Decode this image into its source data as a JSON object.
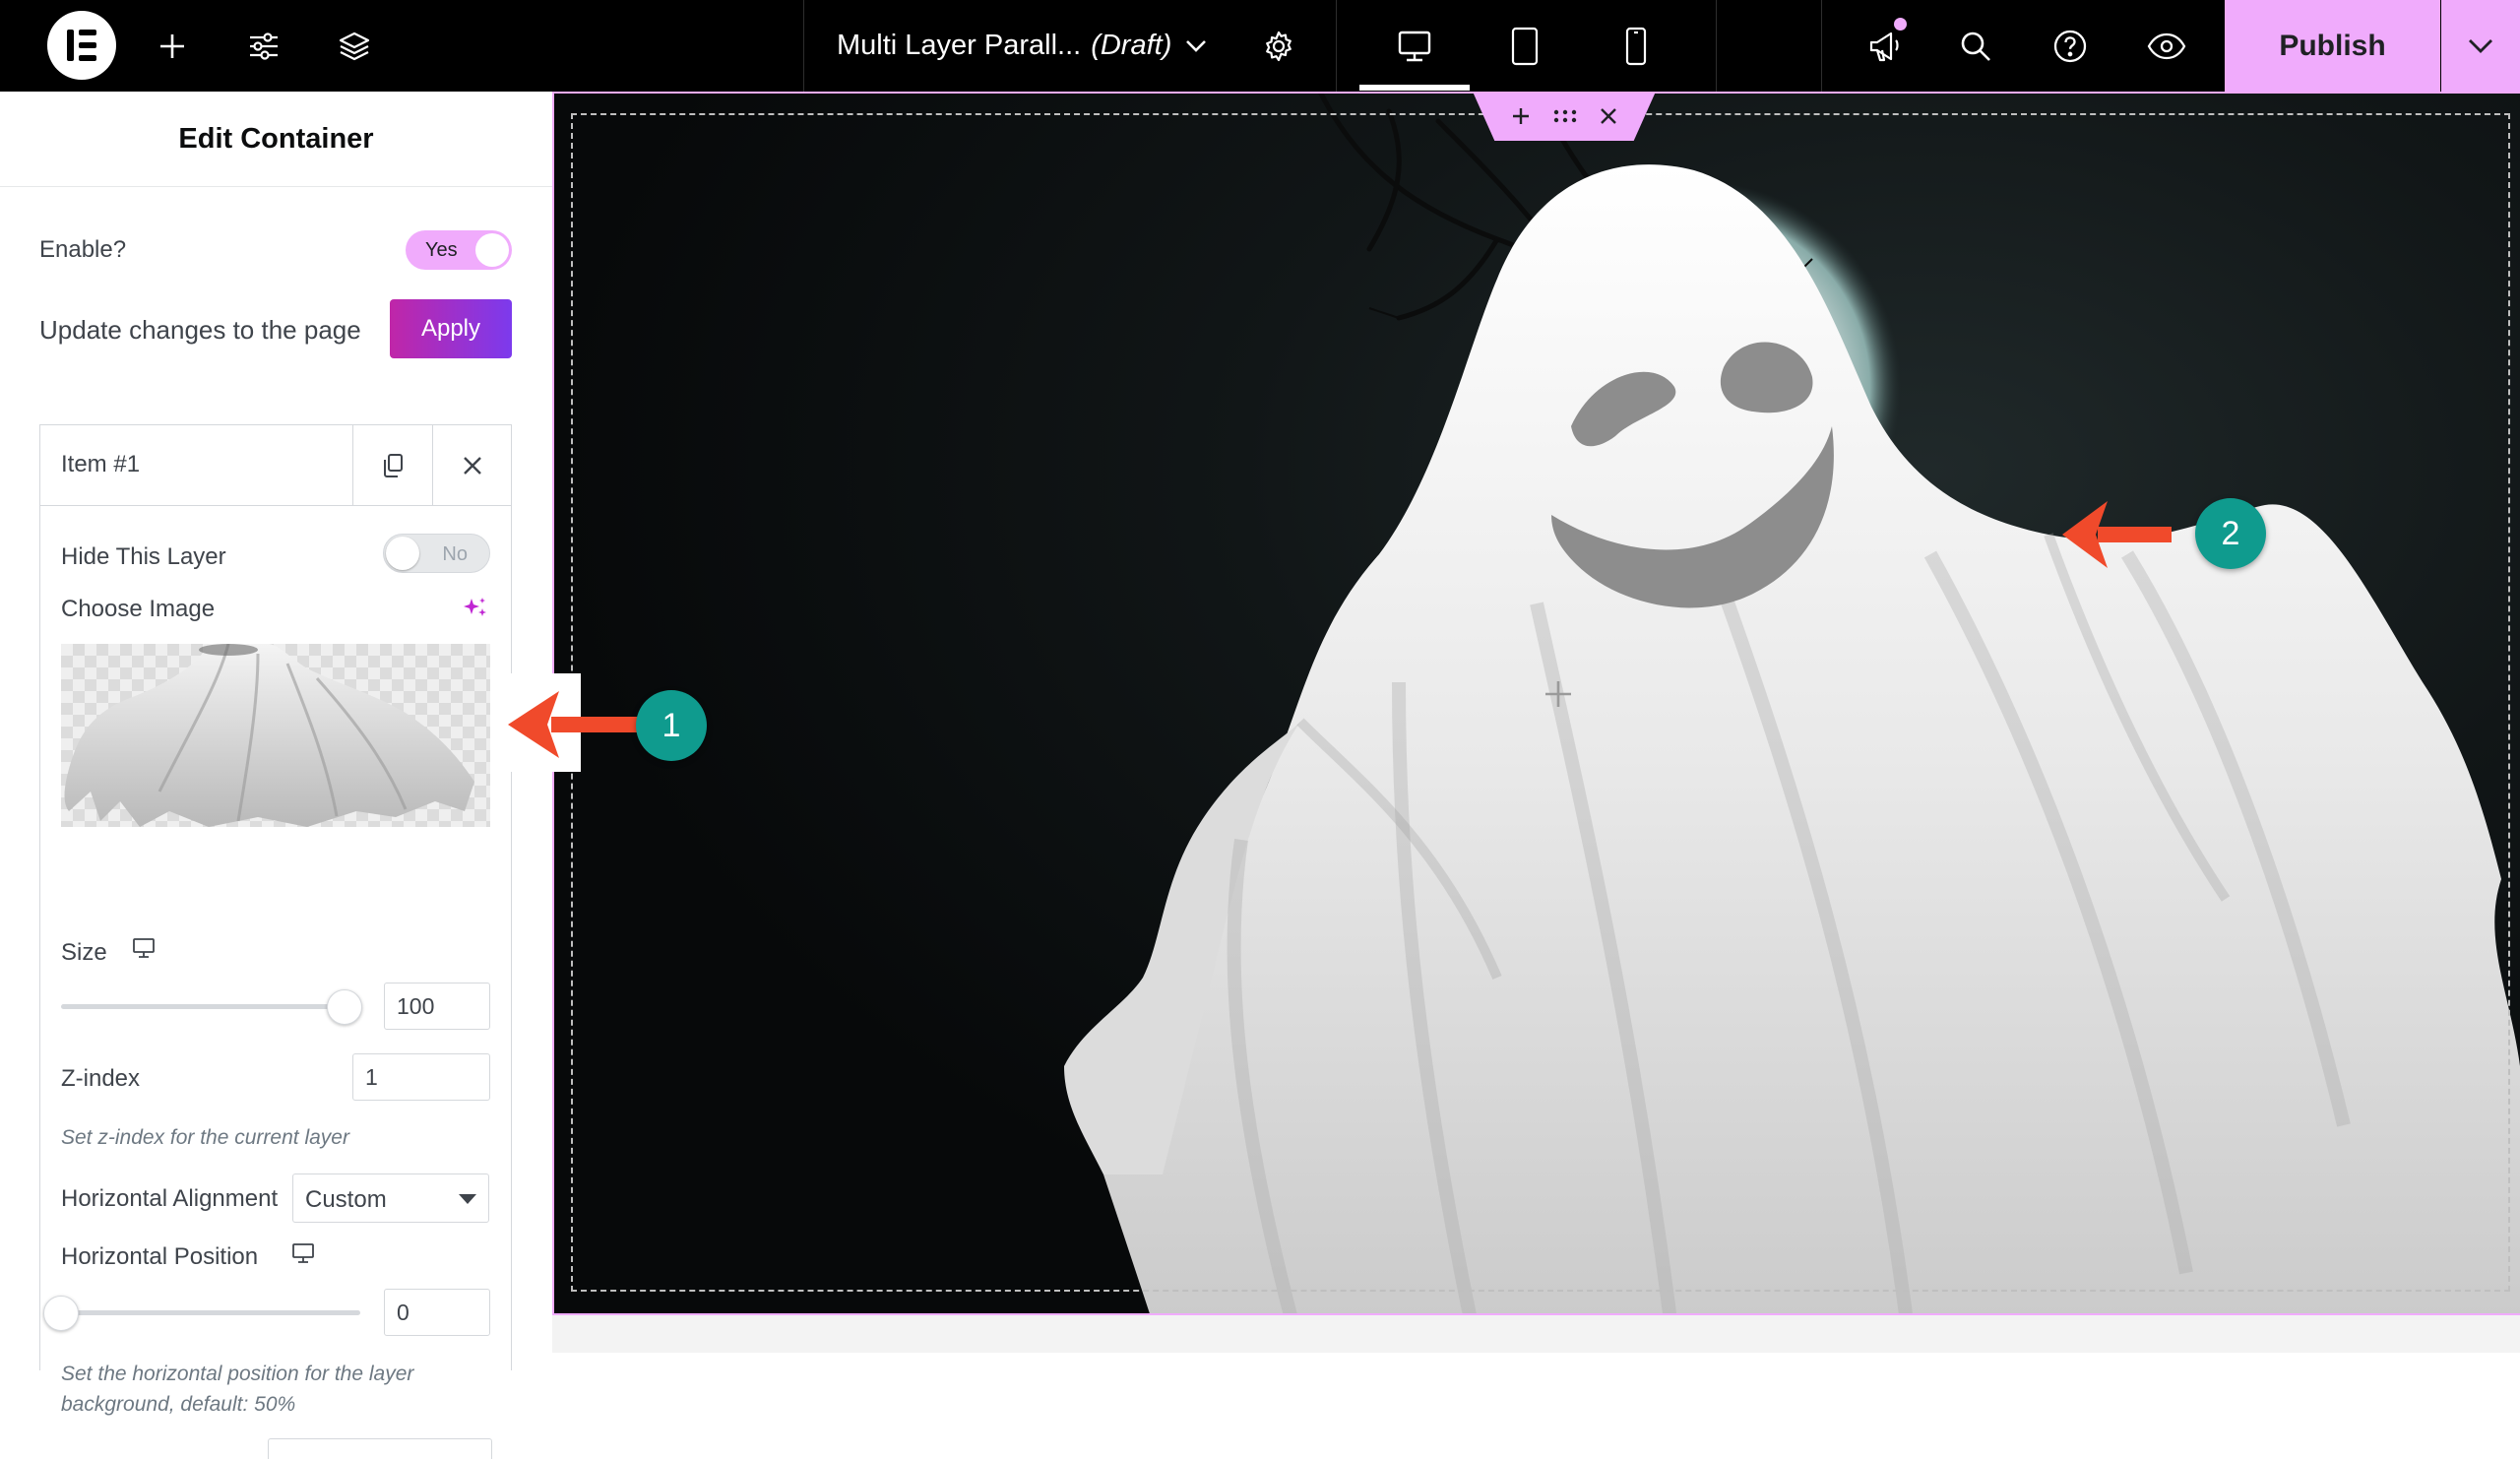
{
  "topbar": {
    "document_title": "Multi Layer Parall...",
    "document_status": "(Draft)",
    "publish_label": "Publish",
    "colors": {
      "background": "#000000",
      "accent": "#f0abfc"
    },
    "icons": [
      "elementor-logo-icon",
      "add-element-icon",
      "site-settings-icon",
      "structure-layers-icon",
      "chevron-down-icon",
      "page-settings-gear-icon",
      "desktop-icon",
      "tablet-icon",
      "mobile-icon",
      "notifications-megaphone-icon",
      "search-icon",
      "help-icon",
      "preview-eye-icon"
    ]
  },
  "panel": {
    "title": "Edit Container",
    "enable_label": "Enable?",
    "enable_toggle_text": "Yes",
    "update_label": "Update changes to the page",
    "apply_label": "Apply",
    "item": {
      "title": "Item #1",
      "hide_layer_label": "Hide This Layer",
      "hide_layer_toggle_text": "No",
      "choose_image_label": "Choose Image",
      "size_label": "Size",
      "size_value": "100",
      "size_percent": 100,
      "zindex_label": "Z-index",
      "zindex_value": "1",
      "zindex_hint": "Set z-index for the current layer",
      "horizontal_alignment_label": "Horizontal Alignment",
      "horizontal_alignment_value": "Custom",
      "horizontal_position_label": "Horizontal Position",
      "horizontal_position_value": "0",
      "horizontal_position_percent": 0,
      "horizontal_position_hint": "Set the horizontal position for the layer background, default: 50%"
    }
  },
  "canvas": {
    "callouts": [
      {
        "number": "1"
      },
      {
        "number": "2"
      }
    ],
    "colors": {
      "callout_badge": "#0f9b8e",
      "callout_arrow": "#f04a2b",
      "outline": "#f0abfc"
    }
  }
}
